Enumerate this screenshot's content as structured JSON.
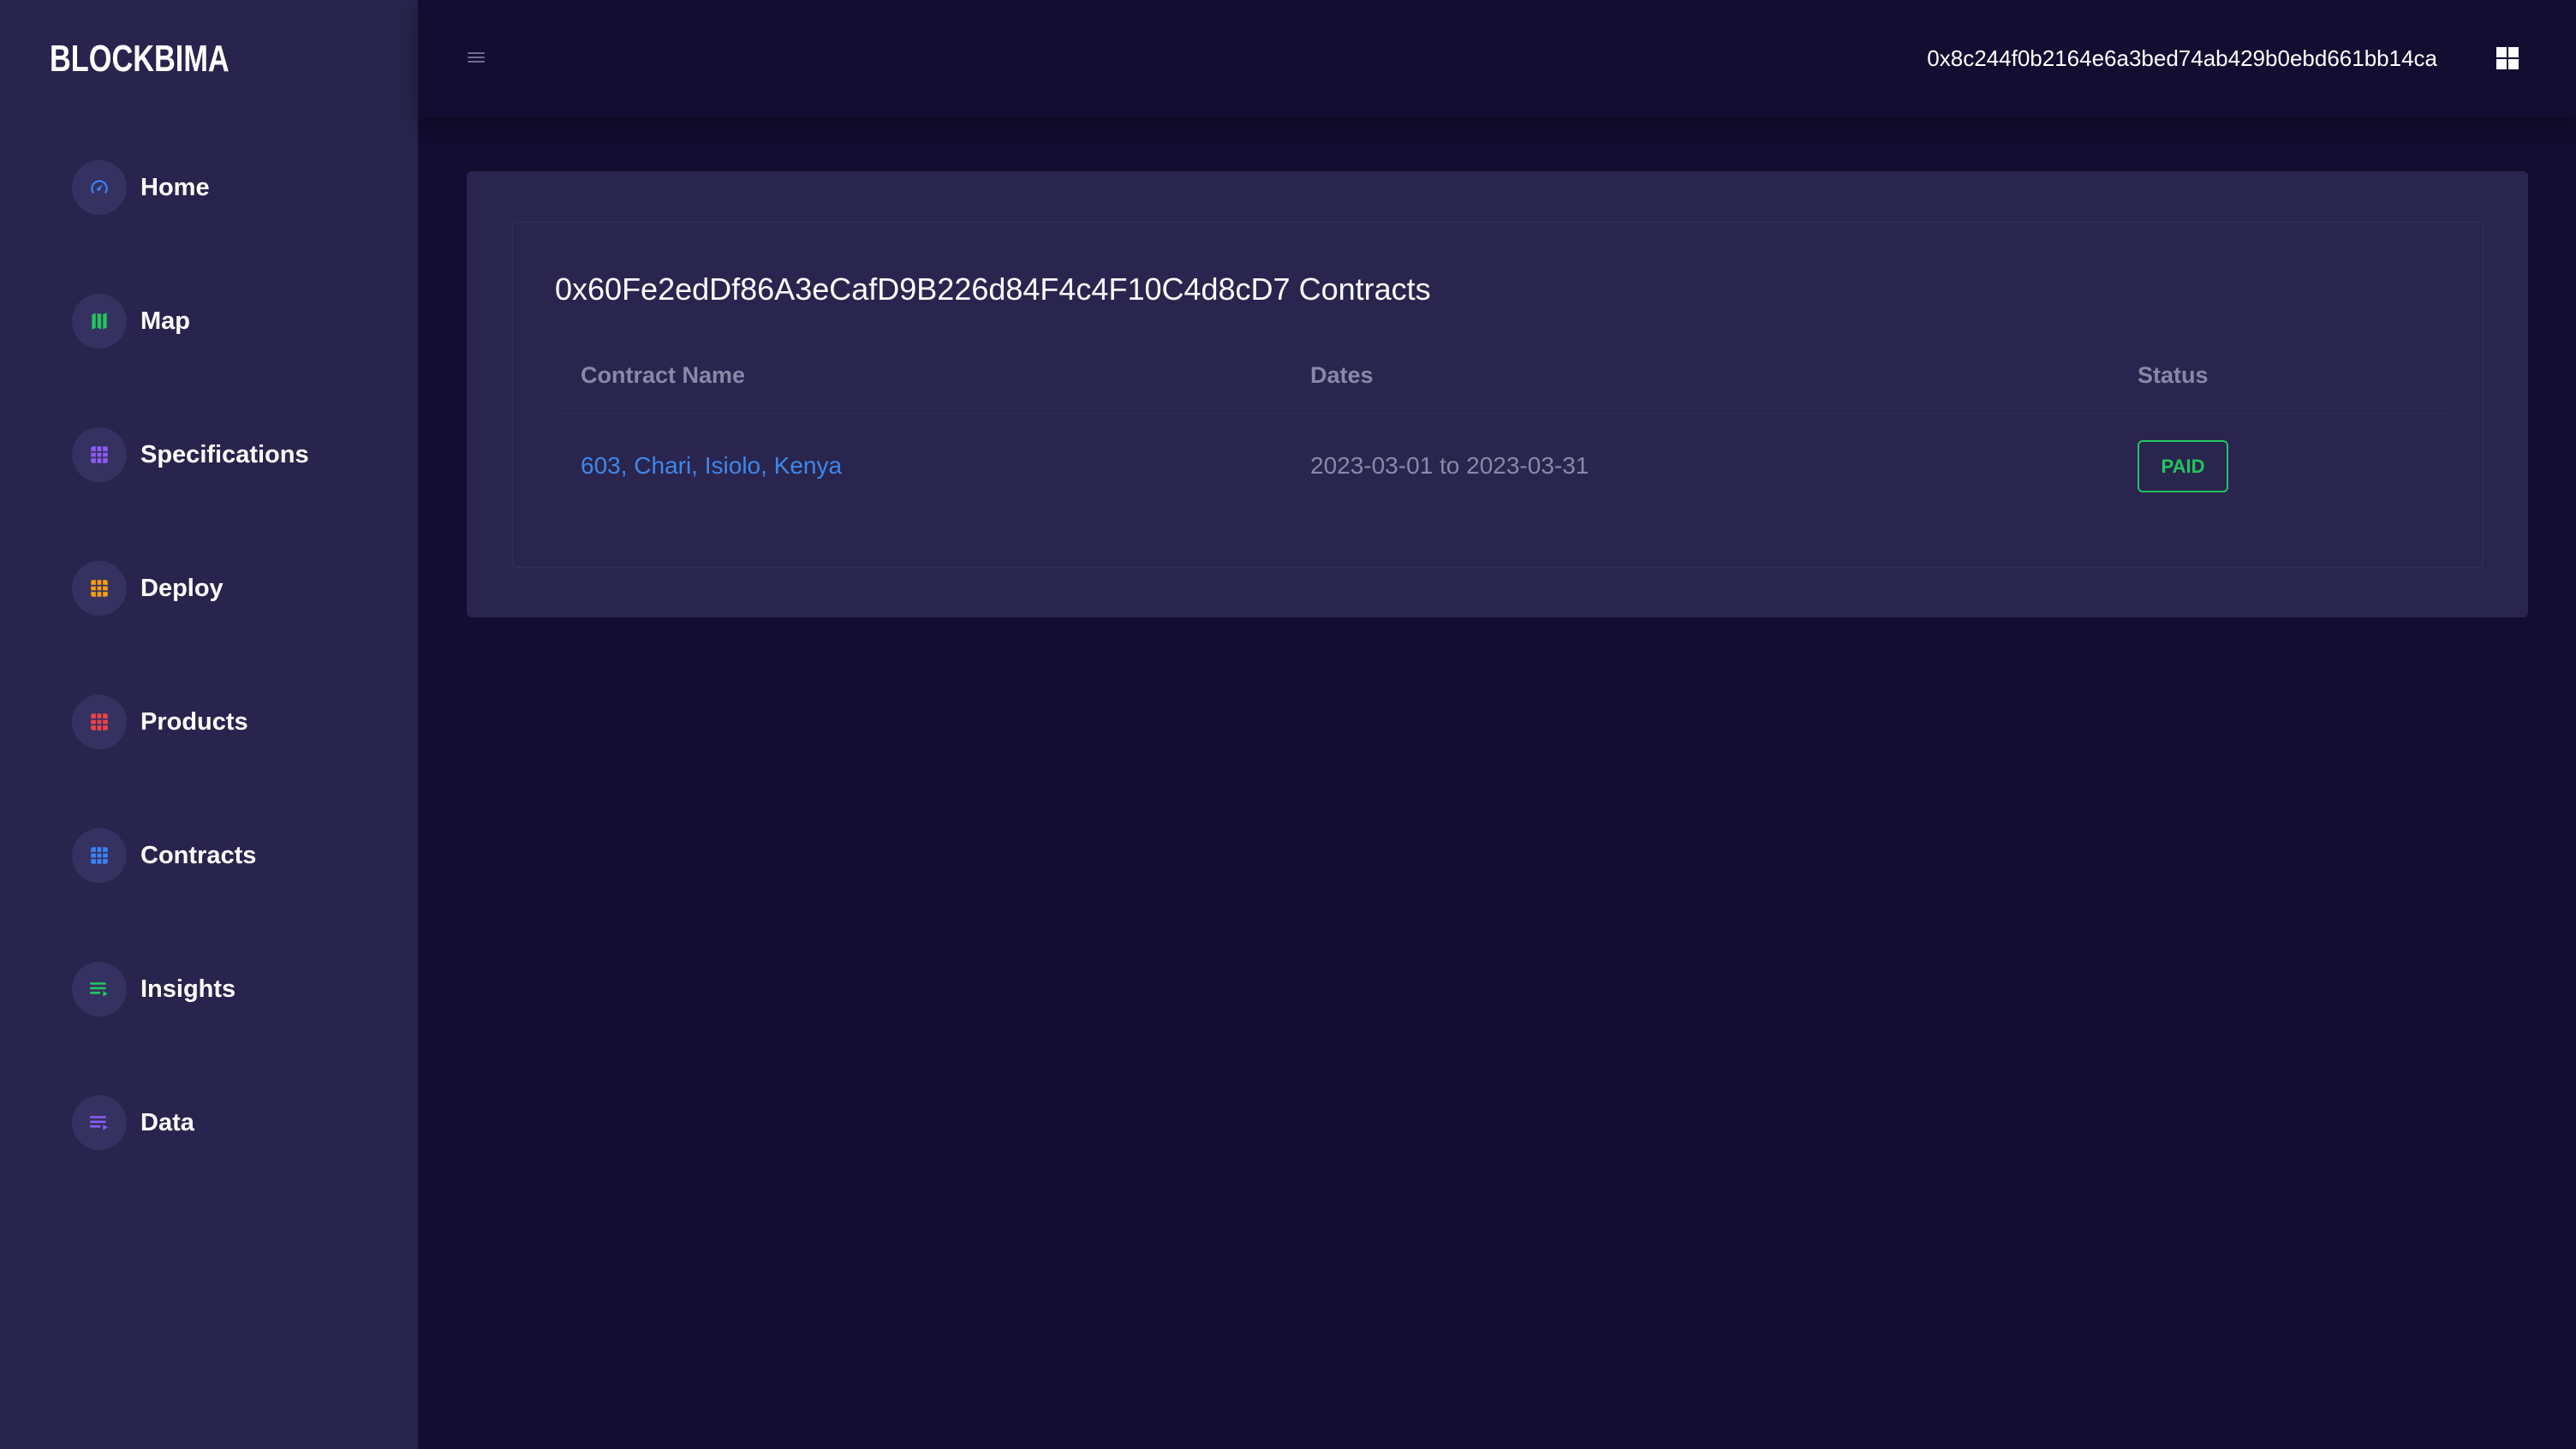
{
  "brand": {
    "logo_text": "BLOCKBIMA"
  },
  "sidebar": {
    "items": [
      {
        "label": "Home",
        "icon": "speedometer-icon",
        "color": "#3b82f6"
      },
      {
        "label": "Map",
        "icon": "map-icon",
        "color": "#22c55e"
      },
      {
        "label": "Specifications",
        "icon": "grid-icon",
        "color": "#8b5cf6"
      },
      {
        "label": "Deploy",
        "icon": "grid-icon",
        "color": "#f59e0b"
      },
      {
        "label": "Products",
        "icon": "grid-icon",
        "color": "#ef4444"
      },
      {
        "label": "Contracts",
        "icon": "grid-icon",
        "color": "#3b82f6"
      },
      {
        "label": "Insights",
        "icon": "list-icon",
        "color": "#22c55e"
      },
      {
        "label": "Data",
        "icon": "list-icon",
        "color": "#8b5cf6"
      }
    ]
  },
  "header": {
    "wallet_address": "0x8c244f0b2164e6a3bed74ab429b0ebd661bb14ca",
    "menu_icon": "hamburger-icon",
    "apps_icon": "apps-grid-icon"
  },
  "main": {
    "title": "0x60Fe2edDf86A3eCafD9B226d84F4c4F10C4d8cD7 Contracts",
    "table": {
      "columns": [
        "Contract Name",
        "Dates",
        "Status"
      ],
      "rows": [
        {
          "name": "603, Chari, Isiolo, Kenya",
          "dates": "2023-03-01 to 2023-03-31",
          "status": "PAID"
        }
      ]
    }
  },
  "colors": {
    "background": "#130d31",
    "sidebar": "#28244d",
    "card": "#29254f",
    "link": "#3f87e8",
    "paid": "#22c55e"
  }
}
